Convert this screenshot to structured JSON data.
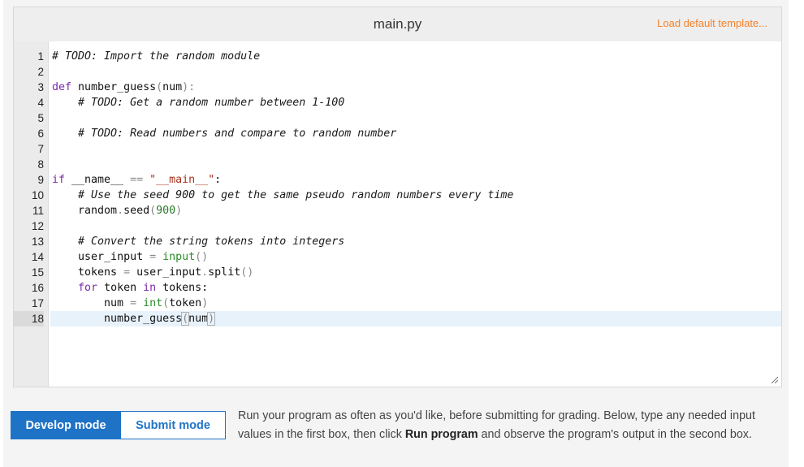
{
  "editor": {
    "file_title": "main.py",
    "load_template_label": "Load default template...",
    "colors": {
      "accent_orange": "#f5822a",
      "accent_blue": "#1f73c7"
    },
    "lines": [
      {
        "n": "1",
        "indent": "",
        "tokens": [
          {
            "t": "comment",
            "v": "# TODO: Import the random module"
          }
        ]
      },
      {
        "n": "2",
        "indent": "",
        "tokens": []
      },
      {
        "n": "3",
        "indent": "",
        "tokens": [
          {
            "t": "kw",
            "v": "def"
          },
          {
            "t": "plain",
            "v": " number_guess"
          },
          {
            "t": "op",
            "v": "("
          },
          {
            "t": "plain",
            "v": "num"
          },
          {
            "t": "op",
            "v": "):"
          }
        ]
      },
      {
        "n": "4",
        "indent": "    ",
        "tokens": [
          {
            "t": "comment",
            "v": "# TODO: Get a random number between 1-100"
          }
        ]
      },
      {
        "n": "5",
        "indent": "",
        "tokens": []
      },
      {
        "n": "6",
        "indent": "    ",
        "tokens": [
          {
            "t": "comment",
            "v": "# TODO: Read numbers and compare to random number"
          }
        ]
      },
      {
        "n": "7",
        "indent": "",
        "tokens": []
      },
      {
        "n": "8",
        "indent": "",
        "tokens": []
      },
      {
        "n": "9",
        "indent": "",
        "tokens": [
          {
            "t": "kw",
            "v": "if"
          },
          {
            "t": "plain",
            "v": " __name__ "
          },
          {
            "t": "op",
            "v": "=="
          },
          {
            "t": "plain",
            "v": " "
          },
          {
            "t": "str",
            "v": "\"__main__\""
          },
          {
            "t": "plain",
            "v": ":"
          }
        ]
      },
      {
        "n": "10",
        "indent": "    ",
        "tokens": [
          {
            "t": "comment",
            "v": "# Use the seed 900 to get the same pseudo random numbers every time"
          }
        ]
      },
      {
        "n": "11",
        "indent": "    ",
        "tokens": [
          {
            "t": "plain",
            "v": "random"
          },
          {
            "t": "op",
            "v": "."
          },
          {
            "t": "plain",
            "v": "seed"
          },
          {
            "t": "op",
            "v": "("
          },
          {
            "t": "num",
            "v": "900"
          },
          {
            "t": "op",
            "v": ")"
          }
        ]
      },
      {
        "n": "12",
        "indent": "",
        "tokens": []
      },
      {
        "n": "13",
        "indent": "    ",
        "tokens": [
          {
            "t": "comment",
            "v": "# Convert the string tokens into integers"
          }
        ]
      },
      {
        "n": "14",
        "indent": "    ",
        "tokens": [
          {
            "t": "plain",
            "v": "user_input "
          },
          {
            "t": "op",
            "v": "="
          },
          {
            "t": "plain",
            "v": " "
          },
          {
            "t": "builtin",
            "v": "input"
          },
          {
            "t": "op",
            "v": "()"
          }
        ]
      },
      {
        "n": "15",
        "indent": "    ",
        "tokens": [
          {
            "t": "plain",
            "v": "tokens "
          },
          {
            "t": "op",
            "v": "="
          },
          {
            "t": "plain",
            "v": " user_input"
          },
          {
            "t": "op",
            "v": "."
          },
          {
            "t": "plain",
            "v": "split"
          },
          {
            "t": "op",
            "v": "()"
          }
        ]
      },
      {
        "n": "16",
        "indent": "    ",
        "tokens": [
          {
            "t": "kw",
            "v": "for"
          },
          {
            "t": "plain",
            "v": " token "
          },
          {
            "t": "kw",
            "v": "in"
          },
          {
            "t": "plain",
            "v": " tokens:"
          }
        ]
      },
      {
        "n": "17",
        "indent": "        ",
        "tokens": [
          {
            "t": "plain",
            "v": "num "
          },
          {
            "t": "op",
            "v": "="
          },
          {
            "t": "plain",
            "v": " "
          },
          {
            "t": "builtin",
            "v": "int"
          },
          {
            "t": "op",
            "v": "("
          },
          {
            "t": "plain",
            "v": "token"
          },
          {
            "t": "op",
            "v": ")"
          }
        ]
      },
      {
        "n": "18",
        "indent": "        ",
        "active": true,
        "tokens": [
          {
            "t": "plain",
            "v": "number_guess"
          },
          {
            "t": "bracket",
            "v": "("
          },
          {
            "t": "plain",
            "v": "num"
          },
          {
            "t": "bracket",
            "v": ")"
          },
          {
            "t": "cursor",
            "v": ""
          }
        ]
      }
    ]
  },
  "modes": {
    "develop_label": "Develop mode",
    "submit_label": "Submit mode",
    "active": "develop"
  },
  "instructions": {
    "part1": "Run your program as often as you'd like, before submitting for grading. Below, type any needed input values in the first box, then click ",
    "bold": "Run program",
    "part2": " and observe the program's output in the second box."
  }
}
